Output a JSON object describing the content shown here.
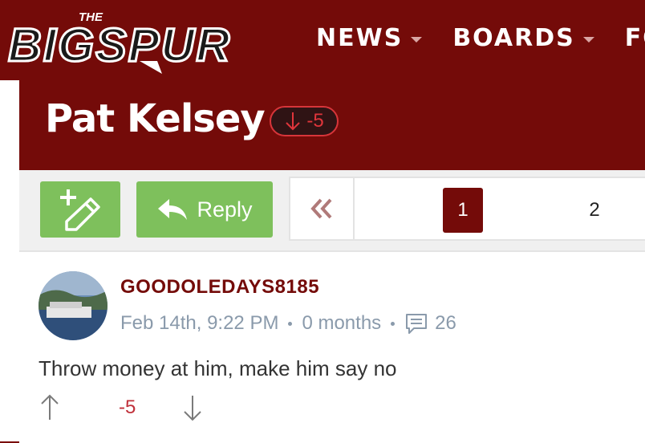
{
  "header": {
    "logo": {
      "small": "THE",
      "main": "BIGSPUR"
    },
    "nav": [
      "NEWS",
      "BOARDS",
      "FO"
    ]
  },
  "thread": {
    "title": "Pat Kelsey",
    "vote_score": "-5"
  },
  "toolbar": {
    "reply_label": "Reply",
    "pages": [
      "1",
      "2"
    ]
  },
  "post": {
    "username": "GOODOLEDAYS8185",
    "date": "Feb 14th, 9:22 PM",
    "age": "0 months",
    "reply_count": "26",
    "text": "Throw money at him, make him say no",
    "score": "-5"
  },
  "colors": {
    "brand": "#740b09",
    "green": "#7ec05c",
    "vote_red": "#c0303a",
    "meta_gray": "#8a9aab"
  }
}
